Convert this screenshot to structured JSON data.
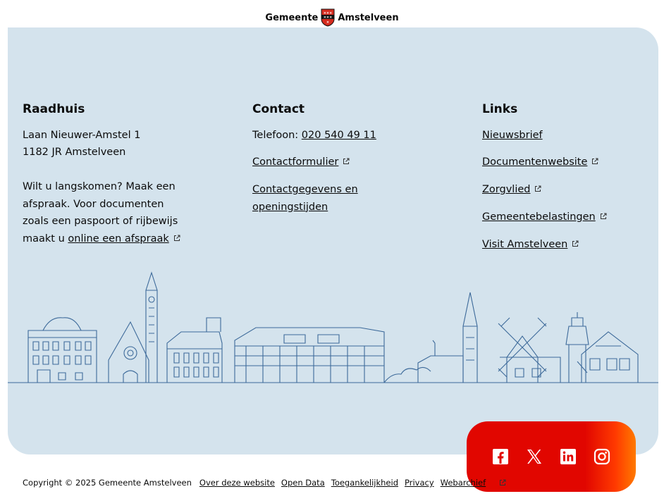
{
  "header": {
    "logo_left": "Gemeente",
    "logo_right": "Amstelveen"
  },
  "raadhuis": {
    "title": "Raadhuis",
    "address_line1": "Laan Nieuwer-Amstel 1",
    "address_line2": "1182 JR Amstelveen",
    "visit_text": "Wilt u langskomen? Maak een afspraak. Voor documenten zoals een paspoort of rijbewijs maakt u",
    "appointment_link": "online een afspraak"
  },
  "contact": {
    "title": "Contact",
    "phone_label": "Telefoon:",
    "phone_number": "020 540 49 11",
    "form_link": "Contactformulier",
    "details_link": "Contactgegevens en openingstijden"
  },
  "links": {
    "title": "Links",
    "items": [
      "Nieuwsbrief",
      "Documentenwebsite",
      "Zorgvlied",
      "Gemeentebelastingen",
      "Visit Amstelveen"
    ]
  },
  "social": {
    "icons": [
      "facebook-icon",
      "x-icon",
      "linkedin-icon",
      "instagram-icon"
    ]
  },
  "footer": {
    "copyright": "Copyright © 2025 Gemeente Amstelveen",
    "links": [
      "Over deze website",
      "Open Data",
      "Toegankelijkheid",
      "Privacy",
      "Webarchief"
    ]
  },
  "colors": {
    "panel": "#d4e3ed",
    "skyline": "#3d6a9a",
    "social_bg": "#e10600",
    "logo_red": "#d52b1e"
  }
}
